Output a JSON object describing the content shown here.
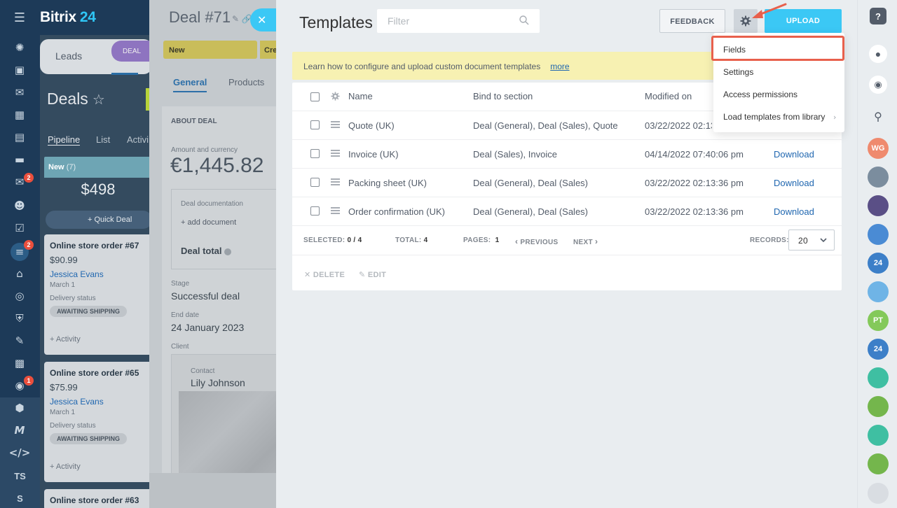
{
  "app": {
    "brand_name": "Bitrix",
    "brand_num": "24"
  },
  "left_nav": {
    "badges": [
      "2",
      "2",
      "1"
    ],
    "text_items": [
      "TS",
      "S"
    ]
  },
  "crm": {
    "leads_tab": "Leads",
    "deal_tab": "DEAL",
    "title": "Deals",
    "subtabs": [
      "Pipeline",
      "List",
      "Activi"
    ],
    "column": {
      "name": "New",
      "count": "(7)",
      "sum": "$498",
      "quick_deal": "+ Quick Deal"
    },
    "cards": [
      {
        "title": "Online store order #67",
        "price": "$90.99",
        "contact": "Jessica Evans",
        "date": "March 1",
        "status_label": "Delivery status",
        "status": "AWAITING SHIPPING",
        "activity": "+ Activity"
      },
      {
        "title": "Online store order #65",
        "price": "$75.99",
        "contact": "Jessica Evans",
        "date": "March 1",
        "status_label": "Delivery status",
        "status": "AWAITING SHIPPING",
        "activity": "+ Activity"
      },
      {
        "title": "Online store order #63"
      }
    ]
  },
  "deal": {
    "title": "Deal #71",
    "stages": [
      "New",
      "Cre"
    ],
    "tabs": [
      "General",
      "Products"
    ],
    "section": "ABOUT DEAL",
    "amount_label": "Amount and currency",
    "amount": "€1,445.82",
    "doc_label": "Deal documentation",
    "add_document": "+ add document",
    "deal_total": "Deal total",
    "stage_label": "Stage",
    "stage_value": "Successful deal",
    "end_date_label": "End date",
    "end_date_value": "24 January 2023",
    "client_label": "Client",
    "contact_label": "Contact",
    "contact_value": "Lily Johnson"
  },
  "templates": {
    "title": "Templates",
    "filter_placeholder": "Filter",
    "feedback": "FEEDBACK",
    "upload": "UPLOAD",
    "banner_text": "Learn how to configure and upload custom document templates",
    "banner_link": "more",
    "columns": [
      "Name",
      "Bind to section",
      "Modified on"
    ],
    "rows": [
      {
        "name": "Quote (UK)",
        "section": "Deal (General), Deal (Sales), Quote",
        "modified": "03/22/2022 02:13:36 pm",
        "action": ""
      },
      {
        "name": "Invoice (UK)",
        "section": "Deal (Sales), Invoice",
        "modified": "04/14/2022 07:40:06 pm",
        "action": "Download"
      },
      {
        "name": "Packing sheet (UK)",
        "section": "Deal (General), Deal (Sales)",
        "modified": "03/22/2022 02:13:36 pm",
        "action": "Download"
      },
      {
        "name": "Order confirmation (UK)",
        "section": "Deal (General), Deal (Sales)",
        "modified": "03/22/2022 02:13:36 pm",
        "action": "Download"
      }
    ],
    "footer": {
      "selected_label": "SELECTED:",
      "selected": "0 / 4",
      "total_label": "TOTAL:",
      "total": "4",
      "pages_label": "PAGES:",
      "pages": "1",
      "previous": "PREVIOUS",
      "next": "NEXT",
      "records_label": "RECORDS:",
      "records": "20"
    },
    "actions": {
      "delete": "DELETE",
      "edit": "EDIT"
    },
    "menu": [
      "Fields",
      "Settings",
      "Access permissions",
      "Load templates from library"
    ]
  },
  "right_bar": {
    "avatars": [
      {
        "initials": "WG",
        "color": "#ef8a6e"
      },
      {
        "initials": "",
        "color": "#7b8d9e"
      },
      {
        "initials": "",
        "color": "#5a4f86"
      },
      {
        "initials": "",
        "color": "#4a8bd4"
      },
      {
        "initials": "24",
        "color": "#3c7fc8"
      },
      {
        "initials": "",
        "color": "#6fb4e6"
      },
      {
        "initials": "PT",
        "color": "#84c95a"
      },
      {
        "initials": "24",
        "color": "#3c7fc8"
      },
      {
        "initials": "",
        "color": "#3fbfa2"
      },
      {
        "initials": "",
        "color": "#74b64c"
      },
      {
        "initials": "",
        "color": "#3fbfa2"
      },
      {
        "initials": "",
        "color": "#74b64c"
      }
    ]
  },
  "colors": {
    "accent": "#3bc8f5",
    "highlight": "#e8604c",
    "link": "#2067b0"
  }
}
